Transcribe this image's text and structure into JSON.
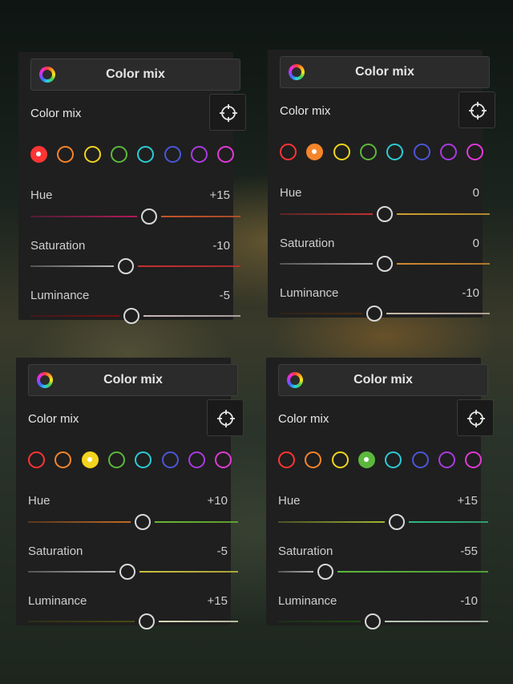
{
  "panels": [
    {
      "header_title": "Color mix",
      "section_label": "Color mix",
      "selected_color": "red",
      "hue": {
        "label": "Hue",
        "value": "+15",
        "position": 0.565
      },
      "saturation": {
        "label": "Saturation",
        "value": "-10",
        "position": 0.455
      },
      "luminance": {
        "label": "Luminance",
        "value": "-5",
        "position": 0.48
      }
    },
    {
      "header_title": "Color mix",
      "section_label": "Color mix",
      "selected_color": "orange",
      "hue": {
        "label": "Hue",
        "value": "0",
        "position": 0.5
      },
      "saturation": {
        "label": "Saturation",
        "value": "0",
        "position": 0.5
      },
      "luminance": {
        "label": "Luminance",
        "value": "-10",
        "position": 0.45
      }
    },
    {
      "header_title": "Color mix",
      "section_label": "Color mix",
      "selected_color": "yellow",
      "hue": {
        "label": "Hue",
        "value": "+10",
        "position": 0.545
      },
      "saturation": {
        "label": "Saturation",
        "value": "-5",
        "position": 0.475
      },
      "luminance": {
        "label": "Luminance",
        "value": "+15",
        "position": 0.565
      }
    },
    {
      "header_title": "Color mix",
      "section_label": "Color mix",
      "selected_color": "green",
      "hue": {
        "label": "Hue",
        "value": "+15",
        "position": 0.565
      },
      "saturation": {
        "label": "Saturation",
        "value": "-55",
        "position": 0.225
      },
      "luminance": {
        "label": "Luminance",
        "value": "-10",
        "position": 0.45
      }
    }
  ],
  "color_swatches": [
    {
      "name": "red",
      "hex": "#ff3434"
    },
    {
      "name": "orange",
      "hex": "#f5852a"
    },
    {
      "name": "yellow",
      "hex": "#f2d51e"
    },
    {
      "name": "green",
      "hex": "#5cb83c"
    },
    {
      "name": "aqua",
      "hex": "#2ccbd6"
    },
    {
      "name": "blue",
      "hex": "#4a57d8"
    },
    {
      "name": "purple",
      "hex": "#a93be0"
    },
    {
      "name": "magenta",
      "hex": "#e03ad6"
    }
  ],
  "track_colors": {
    "red": {
      "hue": [
        "#b01a5a",
        "#c4542a"
      ],
      "sat": [
        "#b9b9b9",
        "#c43030"
      ],
      "lum": [
        "#7a1010",
        "#c9b9b9"
      ]
    },
    "orange": {
      "hue": [
        "#c43030",
        "#d0a030"
      ],
      "sat": [
        "#b9b9b9",
        "#d08a30"
      ],
      "lum": [
        "#4a2a10",
        "#c9b9a9"
      ]
    },
    "yellow": {
      "hue": [
        "#c46a20",
        "#6ab830"
      ],
      "sat": [
        "#b9b9b9",
        "#c8c040"
      ],
      "lum": [
        "#4a4a10",
        "#d9d9b9"
      ]
    },
    "green": {
      "hue": [
        "#a0b830",
        "#30b880"
      ],
      "sat": [
        "#b9b9b9",
        "#5cb83c"
      ],
      "lum": [
        "#1e4a10",
        "#b9c9b9"
      ]
    }
  }
}
